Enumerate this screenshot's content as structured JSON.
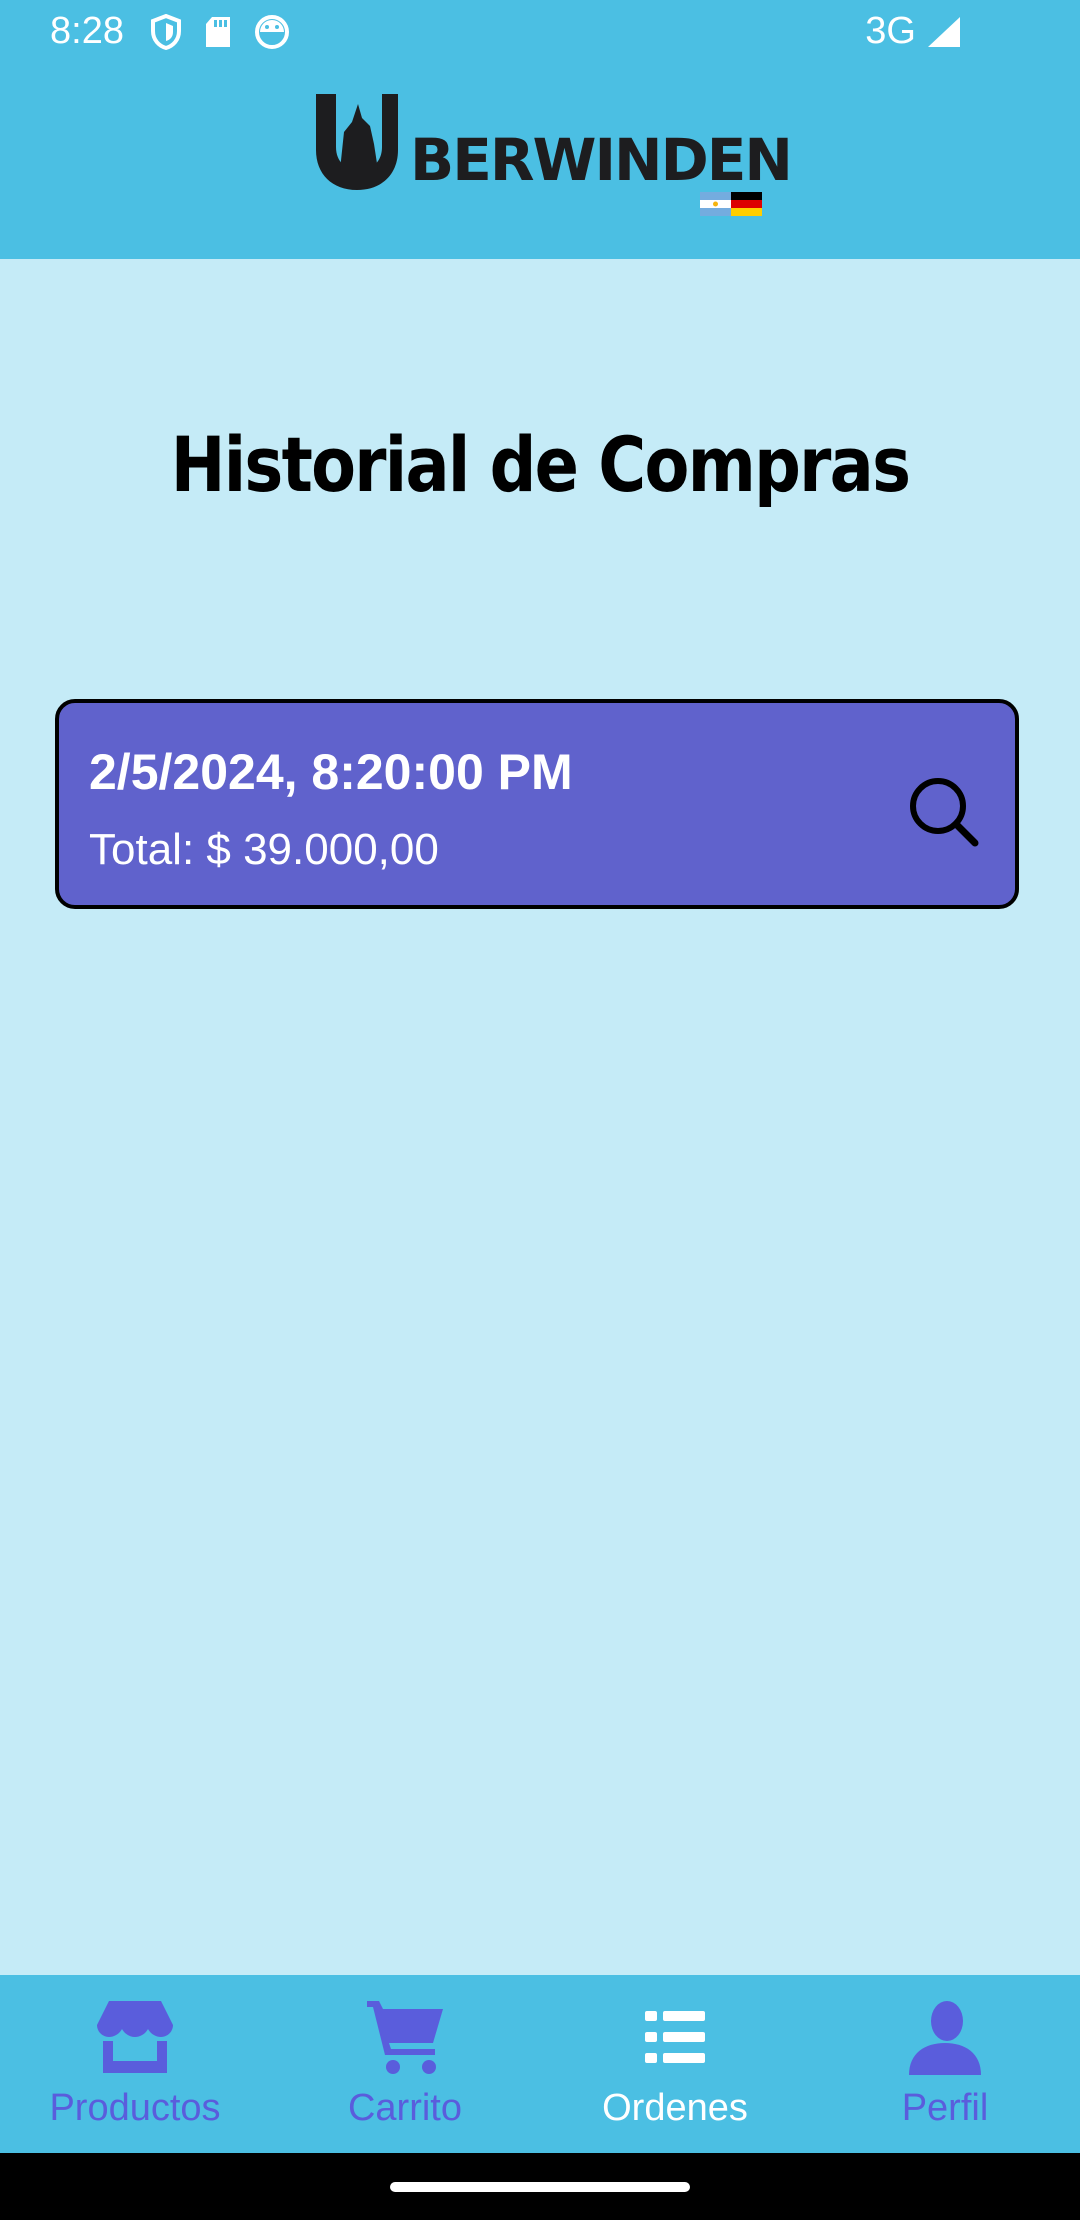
{
  "status_bar": {
    "time": "8:28",
    "network": "3G",
    "icons": [
      "shield-icon",
      "sd-card-icon",
      "android-face-icon",
      "signal-icon"
    ]
  },
  "header": {
    "logo_text": "BERWINDEN",
    "background": "#4bbfe3"
  },
  "page": {
    "title": "Historial de Compras",
    "background": "#c5ebf7"
  },
  "orders": [
    {
      "date": "2/5/2024, 8:20:00 PM",
      "total": "Total: $ 39.000,00",
      "icon": "search-icon",
      "color": "#6062cc"
    }
  ],
  "nav": {
    "items": [
      {
        "label": "Productos",
        "icon": "store-icon",
        "active": false
      },
      {
        "label": "Carrito",
        "icon": "cart-icon",
        "active": false
      },
      {
        "label": "Ordenes",
        "icon": "list-icon",
        "active": true
      },
      {
        "label": "Perfil",
        "icon": "person-icon",
        "active": false
      }
    ],
    "accent": "#5a5ddc"
  }
}
